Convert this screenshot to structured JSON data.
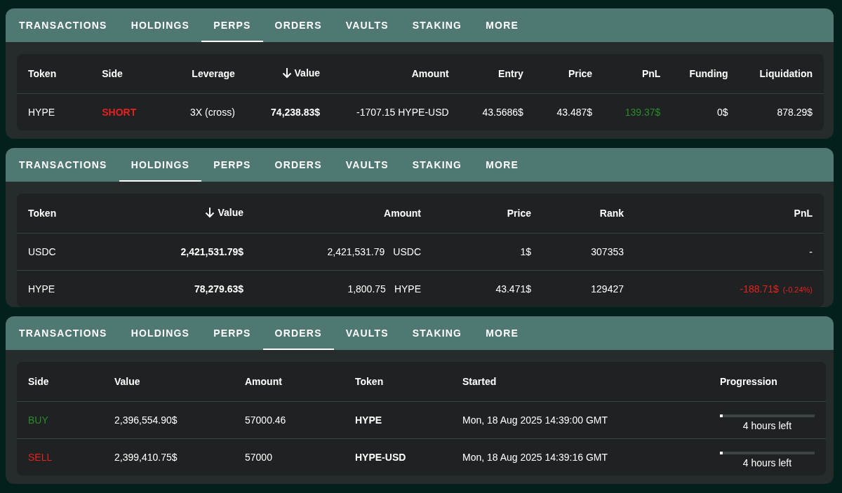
{
  "panels": [
    {
      "tabs": [
        {
          "label": "TRANSACTIONS",
          "selected": false
        },
        {
          "label": "HOLDINGS",
          "selected": false
        },
        {
          "label": "PERPS",
          "selected": true
        },
        {
          "label": "ORDERS",
          "selected": false
        },
        {
          "label": "VAULTS",
          "selected": false
        },
        {
          "label": "STAKING",
          "selected": false
        },
        {
          "label": "MORE",
          "selected": false
        }
      ],
      "table": {
        "columns": [
          {
            "label": "Token",
            "sorted": false
          },
          {
            "label": "Side",
            "sorted": false
          },
          {
            "label": "Leverage",
            "sorted": false
          },
          {
            "label": "Value",
            "sorted": true
          },
          {
            "label": "Amount",
            "sorted": false
          },
          {
            "label": "Entry",
            "sorted": false
          },
          {
            "label": "Price",
            "sorted": false
          },
          {
            "label": "PnL",
            "sorted": false
          },
          {
            "label": "Funding",
            "sorted": false
          },
          {
            "label": "Liquidation",
            "sorted": false
          }
        ],
        "rows": [
          {
            "cells": [
              {
                "kind": "text",
                "text": "HYPE"
              },
              {
                "kind": "sell-bold",
                "text": "SHORT"
              },
              {
                "kind": "text",
                "text": "3X (cross)"
              },
              {
                "kind": "bold",
                "text": "74,238.83$"
              },
              {
                "kind": "text",
                "text": "-1707.15 HYPE-USD"
              },
              {
                "kind": "text",
                "text": "43.5686$"
              },
              {
                "kind": "text",
                "text": "43.487$"
              },
              {
                "kind": "gain",
                "text": "139.37$"
              },
              {
                "kind": "text",
                "text": "0$"
              },
              {
                "kind": "text",
                "text": "878.29$"
              }
            ]
          }
        ]
      }
    },
    {
      "tabs": [
        {
          "label": "TRANSACTIONS",
          "selected": false
        },
        {
          "label": "HOLDINGS",
          "selected": true
        },
        {
          "label": "PERPS",
          "selected": false
        },
        {
          "label": "ORDERS",
          "selected": false
        },
        {
          "label": "VAULTS",
          "selected": false
        },
        {
          "label": "STAKING",
          "selected": false
        },
        {
          "label": "MORE",
          "selected": false
        }
      ],
      "table": {
        "columns": [
          {
            "label": "Token",
            "sorted": false
          },
          {
            "label": "Value",
            "sorted": true
          },
          {
            "label": "Amount",
            "sorted": false
          },
          {
            "label": "Price",
            "sorted": false
          },
          {
            "label": "Rank",
            "sorted": false
          },
          {
            "label": "PnL",
            "sorted": false
          }
        ],
        "rows": [
          {
            "cells": [
              {
                "kind": "text",
                "text": "USDC"
              },
              {
                "kind": "bold",
                "text": "2,421,531.79$"
              },
              {
                "kind": "amount",
                "text": "2,421,531.79",
                "unit": "USDC"
              },
              {
                "kind": "text",
                "text": "1$"
              },
              {
                "kind": "text",
                "text": "307353"
              },
              {
                "kind": "text",
                "text": "-"
              }
            ]
          },
          {
            "cells": [
              {
                "kind": "text",
                "text": "HYPE"
              },
              {
                "kind": "bold",
                "text": "78,279.63$"
              },
              {
                "kind": "amount",
                "text": "1,800.75",
                "unit": "HYPE"
              },
              {
                "kind": "text",
                "text": "43.471$"
              },
              {
                "kind": "text",
                "text": "129427"
              },
              {
                "kind": "loss",
                "text": "-188.71$",
                "note": "(-0.24%)"
              }
            ]
          }
        ]
      }
    },
    {
      "tabs": [
        {
          "label": "TRANSACTIONS",
          "selected": false
        },
        {
          "label": "HOLDINGS",
          "selected": false
        },
        {
          "label": "PERPS",
          "selected": false
        },
        {
          "label": "ORDERS",
          "selected": true
        },
        {
          "label": "VAULTS",
          "selected": false
        },
        {
          "label": "STAKING",
          "selected": false
        },
        {
          "label": "MORE",
          "selected": false
        }
      ],
      "table": {
        "columns": [
          {
            "label": "Side",
            "sorted": false
          },
          {
            "label": "Value",
            "sorted": false
          },
          {
            "label": "Amount",
            "sorted": false
          },
          {
            "label": "Token",
            "sorted": false
          },
          {
            "label": "Started",
            "sorted": false
          },
          {
            "label": "Progression",
            "sorted": false
          }
        ],
        "rows": [
          {
            "cells": [
              {
                "kind": "buy",
                "text": "BUY"
              },
              {
                "kind": "text",
                "text": "2,396,554.90$"
              },
              {
                "kind": "text",
                "text": "57000.46"
              },
              {
                "kind": "bold",
                "text": "HYPE"
              },
              {
                "kind": "text",
                "text": "Mon, 18 Aug 2025 14:39:00 GMT"
              },
              {
                "kind": "progress",
                "text": "4 hours left",
                "level": 0.03
              }
            ]
          },
          {
            "cells": [
              {
                "kind": "sell",
                "text": "SELL"
              },
              {
                "kind": "text",
                "text": "2,399,410.75$"
              },
              {
                "kind": "text",
                "text": "57000"
              },
              {
                "kind": "bold",
                "text": "HYPE-USD"
              },
              {
                "kind": "text",
                "text": "Mon, 18 Aug 2025 14:39:16 GMT"
              },
              {
                "kind": "progress",
                "text": "4 hours left",
                "level": 0.03
              }
            ]
          }
        ]
      }
    }
  ]
}
